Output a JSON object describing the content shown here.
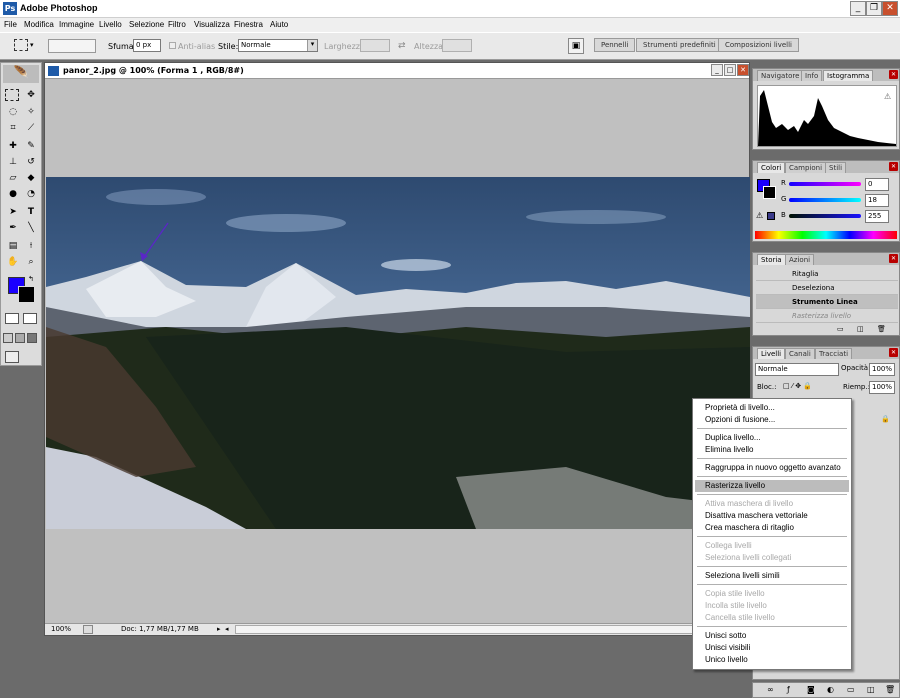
{
  "window": {
    "title": "Adobe Photoshop",
    "icon": "photoshop-icon"
  },
  "menu": [
    "File",
    "Modifica",
    "Immagine",
    "Livello",
    "Selezione",
    "Filtro",
    "Visualizza",
    "Finestra",
    "Aiuto"
  ],
  "options": {
    "sfuma_label": "Sfuma:",
    "sfuma_value": "0 px",
    "antialias_label": "Anti-alias",
    "stile_label": "Stile:",
    "stile_value": "Normale",
    "larghezza_label": "Larghezza:",
    "altezza_label": "Altezza:"
  },
  "well_tabs": [
    "Pennelli",
    "Strumenti predefiniti",
    "Composizioni livelli"
  ],
  "document": {
    "title": "panor_2.jpg @ 100% (Forma 1 , RGB/8#)",
    "zoom": "100%",
    "doc_info": "Doc: 1,77 MB/1,77 MB"
  },
  "nav_panel": {
    "tabs": [
      "Navigatore",
      "Info",
      "Istogramma"
    ]
  },
  "color_panel": {
    "tabs": [
      "Colori",
      "Campioni",
      "Stili"
    ],
    "r": "0",
    "g": "18",
    "b": "255",
    "r_label": "R",
    "g_label": "G",
    "b_label": "B"
  },
  "history_panel": {
    "tabs": [
      "Storia",
      "Azioni"
    ],
    "items": [
      "Ritaglia",
      "Deseleziona",
      "Strumento Linea",
      "Rasterizza livello"
    ]
  },
  "layers_panel": {
    "tabs": [
      "Livelli",
      "Canali",
      "Tracciati"
    ],
    "blend": "Normale",
    "opacity_label": "Opacità:",
    "opacity": "100%",
    "lock_label": "Bloc.:",
    "fill_label": "Riemp.:",
    "fill": "100%"
  },
  "context_menu": [
    {
      "label": "Proprietà di livello...",
      "enabled": true
    },
    {
      "label": "Opzioni di fusione...",
      "enabled": true
    },
    {
      "sep": true
    },
    {
      "label": "Duplica livello...",
      "enabled": true
    },
    {
      "label": "Elimina livello",
      "enabled": true
    },
    {
      "sep": true
    },
    {
      "label": "Raggruppa in nuovo oggetto avanzato",
      "enabled": true
    },
    {
      "sep": true
    },
    {
      "label": "Rasterizza livello",
      "enabled": true,
      "highlighted": true
    },
    {
      "sep": true
    },
    {
      "label": "Attiva maschera di livello",
      "enabled": false
    },
    {
      "label": "Disattiva maschera vettoriale",
      "enabled": true
    },
    {
      "label": "Crea maschera di ritaglio",
      "enabled": true
    },
    {
      "sep": true
    },
    {
      "label": "Collega livelli",
      "enabled": false
    },
    {
      "label": "Seleziona livelli collegati",
      "enabled": false
    },
    {
      "sep": true
    },
    {
      "label": "Seleziona livelli simili",
      "enabled": true
    },
    {
      "sep": true
    },
    {
      "label": "Copia stile livello",
      "enabled": false
    },
    {
      "label": "Incolla stile livello",
      "enabled": false
    },
    {
      "label": "Cancella stile livello",
      "enabled": false
    },
    {
      "sep": true
    },
    {
      "label": "Unisci sotto",
      "enabled": true
    },
    {
      "label": "Unisci visibili",
      "enabled": true
    },
    {
      "label": "Unico livello",
      "enabled": true
    }
  ],
  "colors": {
    "foreground": "#1a00ff",
    "background": "#000000",
    "accent": "#0a246a"
  }
}
